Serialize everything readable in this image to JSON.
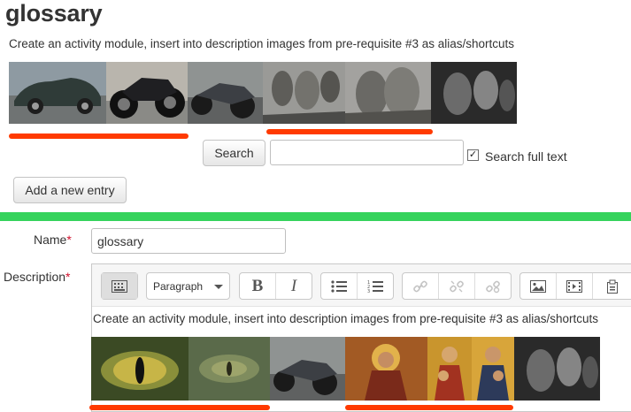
{
  "page": {
    "title": "glossary",
    "intro_text": "Create an activity module, insert into description images from pre-requisite #3 as alias/shortcuts"
  },
  "search": {
    "button_label": "Search",
    "input_value": "",
    "full_text_label": "Search full text",
    "full_text_checked": true
  },
  "actions": {
    "add_entry_label": "Add a new entry"
  },
  "form": {
    "name_label": "Name",
    "name_value": "glossary",
    "description_label": "Description",
    "required_marker": "*",
    "editor": {
      "format_value": "Paragraph",
      "text": "Create an activity module, insert into description images from pre-requisite #3 as alias/shortcuts"
    }
  },
  "colors": {
    "highlight_underline": "#ff3a00",
    "separator_bar": "#35d35c",
    "required": "#d1102c"
  },
  "icons": {
    "toolbar": [
      "show-more-icon",
      "bold-icon",
      "italic-icon",
      "unordered-list-icon",
      "ordered-list-icon",
      "link-icon",
      "unlink-icon",
      "manage-links-icon",
      "image-icon",
      "media-icon",
      "manage-files-icon"
    ]
  }
}
